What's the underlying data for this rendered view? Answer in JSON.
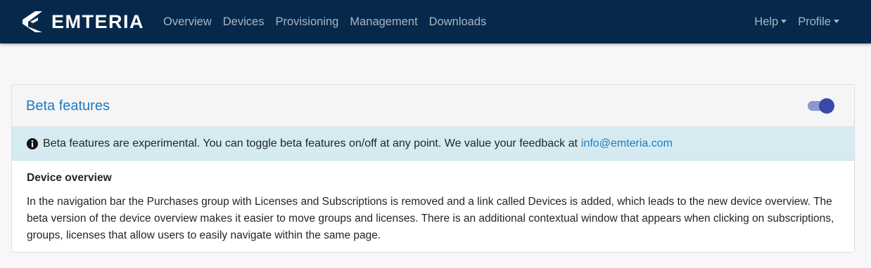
{
  "brand": {
    "name": "EMTERIA",
    "logo": "emteria-logo-icon"
  },
  "nav": {
    "links": [
      "Overview",
      "Devices",
      "Provisioning",
      "Management",
      "Downloads"
    ],
    "help": "Help",
    "profile": "Profile"
  },
  "card": {
    "title": "Beta features",
    "toggle_on": true,
    "alert": {
      "icon": "info-circle-icon",
      "text": "Beta features are experimental. You can toggle beta features on/off at any point. We value your feedback at",
      "email": "info@emteria.com"
    },
    "feature": {
      "title": "Device overview",
      "description": "In the navigation bar the Purchases group with Licenses and Subscriptions is removed and a link called Devices is added, which leads to the new device overview. The beta version of the device overview makes it easier to move groups and licenses. There is an additional contextual window that appears when clicking on subscriptions, groups, licenses that allow users to easily navigate within the same page."
    }
  },
  "colors": {
    "navbar": "#06294b",
    "accent": "#1f7abf",
    "toggle_knob": "#3849a8",
    "alert_bg": "#d5ebf1"
  }
}
